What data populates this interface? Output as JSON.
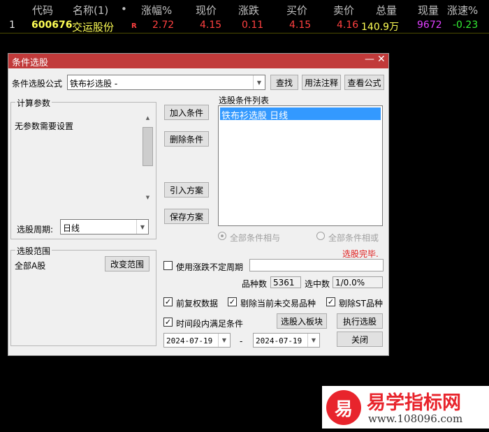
{
  "quote_table": {
    "headers": [
      "代码",
      "名称(1)",
      "•",
      "涨幅%",
      "现价",
      "涨跌",
      "买价",
      "卖价",
      "总量",
      "现量",
      "涨速%"
    ],
    "row": {
      "index": "1",
      "code": "600676",
      "name": "交运股份",
      "flag": "R",
      "change_pct": "2.72",
      "price": "4.15",
      "change": "0.11",
      "bid": "4.15",
      "ask": "4.16",
      "volume": "140.9万",
      "current_volume": "9672",
      "speed": "-0.23"
    }
  },
  "dialog": {
    "title": "条件选股",
    "minimize": "—",
    "close": "✕",
    "formula_label": "条件选股公式",
    "formula_value": "铁布衫选股  -",
    "find_button": "查找",
    "usage_button": "用法注释",
    "view_formula_button": "查看公式",
    "params_group": "计算参数",
    "params_text": "无参数需要设置",
    "period_label": "选股周期:",
    "period_value": "日线",
    "add_button": "加入条件",
    "delete_button": "删除条件",
    "import_button": "引入方案",
    "save_button": "保存方案",
    "condition_list_label": "选股条件列表",
    "conditions": [
      "铁布衫选股  日线"
    ],
    "radio_and": "全部条件相与",
    "radio_or": "全部条件相或",
    "status": "选股完毕.",
    "scope_group": "选股范围",
    "scope_value": "全部A股",
    "change_scope_button": "改变范围",
    "uncertain_period_label": "使用涨跌不定周期",
    "count_label": "品种数",
    "count_value": "5361",
    "selected_label": "选中数",
    "selected_value": "1/0.0%",
    "pre_adjust_label": "前复权数据",
    "remove_untraded_label": "剔除当前未交易品种",
    "remove_st_label": "剔除ST品种",
    "time_range_label": "时间段内满足条件",
    "to_block_button": "选股入板块",
    "execute_button": "执行选股",
    "close_button": "关闭",
    "date_from": "2024-07-19",
    "date_sep": "-",
    "date_to": "2024-07-19"
  },
  "logo": {
    "mark": "易",
    "title": "易学指标网",
    "url": "www.108096.com"
  },
  "colors": {
    "titlebar": "#c13a3a",
    "selection": "#3399ff",
    "status": "#e02020",
    "up": "#ff4040",
    "down": "#33ee33"
  }
}
